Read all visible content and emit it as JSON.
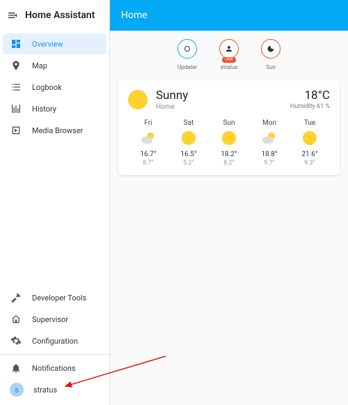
{
  "app": {
    "title": "Home Assistant"
  },
  "sidebar": {
    "items": [
      {
        "label": "Overview"
      },
      {
        "label": "Map"
      },
      {
        "label": "Logbook"
      },
      {
        "label": "History"
      },
      {
        "label": "Media Browser"
      }
    ],
    "tools": [
      {
        "label": "Developer Tools"
      },
      {
        "label": "Supervisor"
      },
      {
        "label": "Configuration"
      }
    ],
    "notifications": {
      "label": "Notifications"
    },
    "user": {
      "label": "stratus",
      "initial": "s"
    }
  },
  "header": {
    "title": "Home"
  },
  "badges": {
    "updater": {
      "label": "Updater",
      "color": "#02a9f4"
    },
    "stratus": {
      "label": "stratus",
      "sub": "UNK",
      "color": "#e8501f"
    },
    "sun": {
      "label": "Sun",
      "color": "#e8501f"
    }
  },
  "weather": {
    "condition": "Sunny",
    "location": "Home",
    "temp": "18°C",
    "humidity": "Humidity 61 %",
    "forecast": [
      {
        "day": "Fri",
        "icon": "partly",
        "hi": "16.7°",
        "lo": "8.7°"
      },
      {
        "day": "Sat",
        "icon": "sun",
        "hi": "16.5°",
        "lo": "5.2°"
      },
      {
        "day": "Sun",
        "icon": "sun",
        "hi": "18.2°",
        "lo": "8.2°"
      },
      {
        "day": "Mon",
        "icon": "partly",
        "hi": "18.8°",
        "lo": "9.7°"
      },
      {
        "day": "Tue",
        "icon": "sun",
        "hi": "21.6°",
        "lo": "9.3°"
      }
    ]
  }
}
